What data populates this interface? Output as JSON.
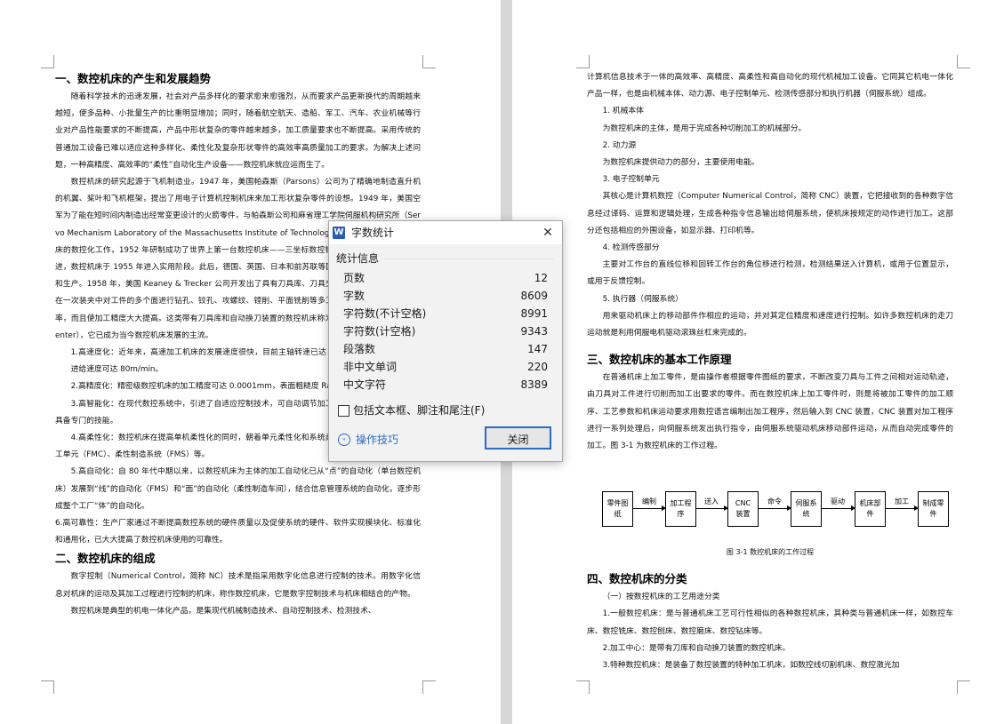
{
  "left_page": {
    "h1": "一、数控机床的产生和发展趋势",
    "p1": "随着科学技术的迅速发展，社会对产品多样化的要求愈来愈强烈，从而要求产品更新换代的周期越来越短，使多品种、小批量生产的比重明显增加；同时，随着航空航天、造船、军工、汽车、农业机械等行业对产品性能要求的不断提高，产品中形状复杂的零件越来越多，加工质量要求也不断提高。采用传统的普通加工设备已难以适应这种多样化、柔性化及复杂形状零件的高效率高质量加工的要求。为解决上述问题，一种高精度、高效率的“柔性”自动化生产设备——数控机床就应运而生了。",
    "p2": "数控机床的研究起源于飞机制造业。1947 年，美国帕森斯（Parsons）公司为了精确地制造直升机的机翼、桨叶和飞机框架，提出了用电子计算机控制机床来加工形状复杂零件的设想。1949 年，美国空军为了能在短时间内制造出经常变更设计的火箭零件，与帕森斯公司和麻省理工学院伺服机构研究所（Servo Mechanism Laboratory of the Massachusetts Institute of Technology）合作，开始了三坐标铣床的数控化工作，1952 年研制成功了世界上第一台数控机床——三坐标数控铣床。经过三年的试用和改进，数控机床于 1955 年进入实用阶段。此后，德国、英国、日本和前苏联等国也开始了数控机床的研制和生产。1958 年，美国 Keaney & Trecker 公司开发出了具有刀具库、刀具交换装置的数控机床，可以在一次装夹中对工件的多个面进行钻孔、铰孔、攻螺纹、镗削、平面铣削等多工序加工，不仅提高了生产率，而且使加工精度大大提高。这类带有刀具库和自动换刀装置的数控机床称为加工中心（Machining Center），它已成为当今数控机床发展的主流。",
    "p3": "1.高速度化：近年来，高速加工机床的发展速度很快，目前主轴转速已达 10000～100000r/min，进给速度可达 80m/min。",
    "p4": "2.高精度化：精密级数控机床的加工精度可达 0.0001mm，表面粗糙度 Ra 可达 0.008μm。",
    "p5": "3.高智能化：在现代数控系统中，引进了自适应控制技术，可自动调节加工参数，从而使操作者不需具备专门的技能。",
    "p6": "4.高柔性化：数控机床在提高单机柔性化的同时，朝着单元柔性化和系统柔性化方向发展，如柔性加工单元（FMC）、柔性制造系统（FMS）等。",
    "p7": "5.高自动化：自 80 年代中期以来，以数控机床为主体的加工自动化已从“点”的自动化（单台数控机床）发展到“线”的自动化（FMS）和“面”的自动化（柔性制造车间），结合信息管理系统的自动化，逐步形成整个工厂“体”的自动化。",
    "p8": "6.高可靠性：生产厂家通过不断提高数控系统的硬件质量以及促使系统的硬件、软件实现模块化、标准化和通用化，已大大提高了数控机床使用的可靠性。",
    "h2": "二、数控机床的组成",
    "p9": "数字控制（Numerical Control，简称 NC）技术是指采用数字化信息进行控制的技术。用数字化信息对机床的运动及其加工过程进行控制的机床，称作数控机床，它是数字控制技术与机床相结合的产物。",
    "p10": "数控机床是典型的机电一体化产品，是集现代机械制造技术、自动控制技术、检测技术、"
  },
  "right_page": {
    "p1": "计算机信息技术于一体的高效率、高精度、高柔性和高自动化的现代机械加工设备。它同其它机电一体化产品一样，也是由机械本体、动力源、电子控制单元、检测传感部分和执行机器（伺服系统）组成。",
    "i1": "1. 机械本体",
    "d1": "为数控机床的主体，是用于完成各种切削加工的机械部分。",
    "i2": "2. 动力源",
    "d2": "为数控机床提供动力的部分，主要使用电能。",
    "i3": "3. 电子控制单元",
    "d3": "其核心是计算机数控（Computer Numerical Control，简称 CNC）装置，它把接收到的各种数字信息经过译码、运算和逻辑处理，生成各种指令信息输出给伺服系统，使机床按规定的动作进行加工。这部分还包括相应的外围设备，如显示器、打印机等。",
    "i4": "4. 检测传感部分",
    "d4": "主要对工作台的直线位移和回转工作台的角位移进行检测，检测结果送入计算机，或用于位置显示，或用于反馈控制。",
    "i5": "5. 执行器（伺服系统）",
    "d5": "用来驱动机床上的移动部件作相应的运动，并对其定位精度和速度进行控制。如许多数控机床的走刀运动就是利用伺服电机驱动滚珠丝杠来完成的。",
    "h3": "三、数控机床的基本工作原理",
    "p2": "在普通机床上加工零件，是由操作者根据零件图纸的要求，不断改变刀具与工件之间相对运动轨迹，由刀具对工件进行切削而加工出要求的零件。而在数控机床上加工零件时，则是将被加工零件的加工顺序、工艺参数和机床运动要求用数控语言编制出加工程序，然后输入到 CNC 装置，CNC 装置对加工程序进行一系列处理后，向伺服系统发出执行指令，由伺服系统驱动机床移动部件运动，从而自动完成零件的加工。图 3-1 为数控机床的工作过程。",
    "flow_boxes": [
      "零件图纸",
      "加工程序",
      "CNC装置",
      "伺服系统",
      "机床部件",
      "制成零件"
    ],
    "flow_labels": [
      "编制",
      "送入",
      "命令",
      "驱动",
      "加工"
    ],
    "caption": "图 3-1  数控机床的工作过程",
    "h4": "四、数控机床的分类",
    "s1": "（一）按数控机床的工艺用途分类",
    "c1": "1.一般数控机床：是与普通机床工艺可行性相似的各种数控机床，其种类与普通机床一样，如数控车床、数控铣床、数控刨床、数控磨床、数控钻床等。",
    "c2": "2.加工中心：是带有刀库和自动换刀装置的数控机床。",
    "c3": "3.特种数控机床：是装备了数控装置的特种加工机床，如数控线切割机床、数控激光加"
  },
  "dialog": {
    "title": "字数统计",
    "app_icon": "W",
    "close_glyph": "✕",
    "group_label": "统计信息",
    "stats": [
      {
        "label": "页数",
        "value": "12"
      },
      {
        "label": "字数",
        "value": "8609"
      },
      {
        "label": "字符数(不计空格)",
        "value": "8991"
      },
      {
        "label": "字符数(计空格)",
        "value": "9343"
      },
      {
        "label": "段落数",
        "value": "147"
      },
      {
        "label": "非中文单词",
        "value": "220"
      },
      {
        "label": "中文字符",
        "value": "8389"
      }
    ],
    "checkbox_label": "包括文本框、脚注和尾注(F)",
    "checkbox_checked": false,
    "tips_label": "操作技巧",
    "close_button": "关闭"
  },
  "colors": {
    "accent": "#2b6bc8",
    "link": "#2e6bc4",
    "gutter": "#d7d7d7"
  }
}
